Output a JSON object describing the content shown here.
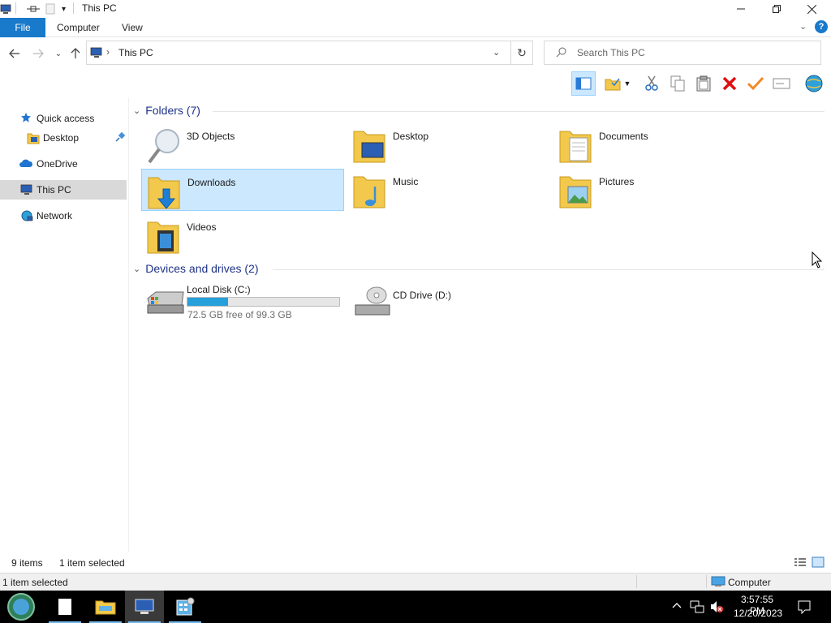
{
  "window": {
    "title": "This PC",
    "controls": {
      "minimize": "—",
      "maximize": "❐",
      "close": "✕"
    }
  },
  "ribbon": {
    "file": "File",
    "tabs": [
      "Computer",
      "View"
    ]
  },
  "address": {
    "separator": "›",
    "path": "This PC",
    "search_placeholder": "Search This PC"
  },
  "sidebar": {
    "items": [
      {
        "label": "Quick access",
        "icon": "star-icon"
      },
      {
        "label": "Desktop",
        "icon": "desktop-folder-icon",
        "pinned": true
      },
      {
        "label": "OneDrive",
        "icon": "cloud-icon"
      },
      {
        "label": "This PC",
        "icon": "computer-icon",
        "selected": true
      },
      {
        "label": "Network",
        "icon": "network-icon"
      }
    ]
  },
  "folders": {
    "header": "Folders (7)",
    "items": [
      {
        "name": "3D Objects",
        "icon": "3d-objects-icon"
      },
      {
        "name": "Desktop",
        "icon": "desktop-folder-icon"
      },
      {
        "name": "Documents",
        "icon": "documents-folder-icon"
      },
      {
        "name": "Downloads",
        "icon": "downloads-folder-icon",
        "selected": true
      },
      {
        "name": "Music",
        "icon": "music-folder-icon"
      },
      {
        "name": "Pictures",
        "icon": "pictures-folder-icon"
      },
      {
        "name": "Videos",
        "icon": "videos-folder-icon"
      }
    ]
  },
  "drives": {
    "header": "Devices and drives (2)",
    "items": [
      {
        "name": "Local Disk (C:)",
        "free": "72.5 GB free of 99.3 GB",
        "used_fraction": 0.27,
        "icon": "hard-drive-icon"
      },
      {
        "name": "CD Drive (D:)",
        "icon": "cd-drive-icon"
      }
    ]
  },
  "status": {
    "count": "9 items",
    "selected": "1 item selected",
    "bottom_left": "1 item selected",
    "bottom_right": "Computer"
  },
  "taskbar": {
    "time": "3:57:55 PM",
    "date": "12/20/2023"
  },
  "colors": {
    "accent": "#1979ca",
    "selection": "#cce8ff",
    "group_header": "#1e3287",
    "drive_bar": "#26a0da"
  }
}
